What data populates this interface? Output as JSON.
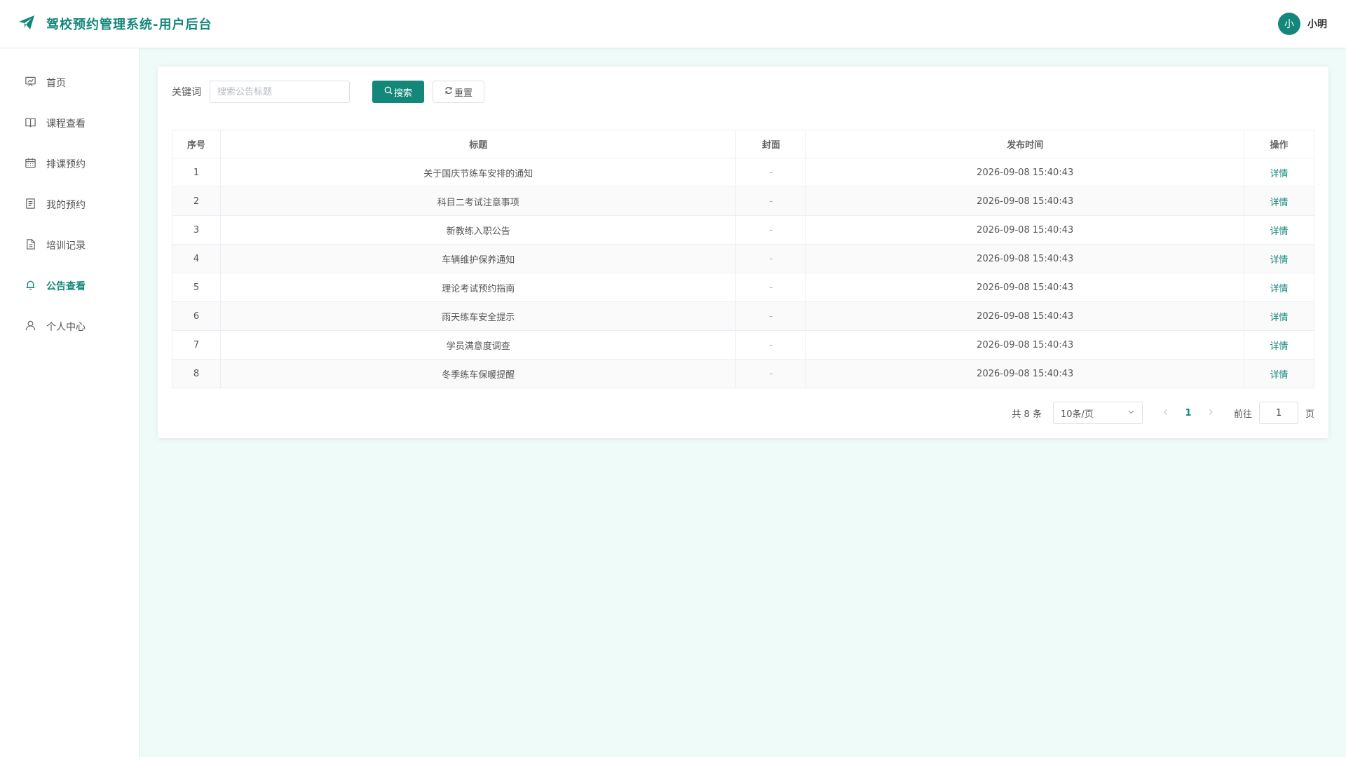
{
  "header": {
    "title": "驾校预约管理系统-用户后台",
    "user_avatar": "小",
    "user_name": "小明",
    "logo_icon": "paper-plane-icon"
  },
  "sidebar": {
    "items": [
      {
        "label": "首页",
        "icon": "chart-board-icon"
      },
      {
        "label": "课程查看",
        "icon": "book-icon"
      },
      {
        "label": "排课预约",
        "icon": "calendar-icon"
      },
      {
        "label": "我的预约",
        "icon": "document-icon"
      },
      {
        "label": "培训记录",
        "icon": "file-icon"
      },
      {
        "label": "公告查看",
        "icon": "bell-icon",
        "active": true
      },
      {
        "label": "个人中心",
        "icon": "user-icon"
      }
    ]
  },
  "search": {
    "label": "关键词",
    "placeholder": "搜索公告标题",
    "value": "",
    "search_label": "搜索",
    "reset_label": "重置"
  },
  "table": {
    "headers": [
      "序号",
      "标题",
      "封面",
      "发布时间",
      "操作"
    ],
    "rows": [
      {
        "seq": "1",
        "title": "关于国庆节练车安排的通知",
        "cover": "-",
        "time": "2026-09-08 15:40:43",
        "action": "详情"
      },
      {
        "seq": "2",
        "title": "科目二考试注意事项",
        "cover": "-",
        "time": "2026-09-08 15:40:43",
        "action": "详情"
      },
      {
        "seq": "3",
        "title": "新教练入职公告",
        "cover": "-",
        "time": "2026-09-08 15:40:43",
        "action": "详情"
      },
      {
        "seq": "4",
        "title": "车辆维护保养通知",
        "cover": "-",
        "time": "2026-09-08 15:40:43",
        "action": "详情"
      },
      {
        "seq": "5",
        "title": "理论考试预约指南",
        "cover": "-",
        "time": "2026-09-08 15:40:43",
        "action": "详情"
      },
      {
        "seq": "6",
        "title": "雨天练车安全提示",
        "cover": "-",
        "time": "2026-09-08 15:40:43",
        "action": "详情"
      },
      {
        "seq": "7",
        "title": "学员满意度调查",
        "cover": "-",
        "time": "2026-09-08 15:40:43",
        "action": "详情"
      },
      {
        "seq": "8",
        "title": "冬季练车保暖提醒",
        "cover": "-",
        "time": "2026-09-08 15:40:43",
        "action": "详情"
      }
    ]
  },
  "pagination": {
    "total_text": "共 8 条",
    "page_size": "10条/页",
    "current_page": "1",
    "goto_label": "前往",
    "goto_value": "1",
    "goto_suffix": "页"
  },
  "colors": {
    "accent": "#13877a",
    "background": "#effbf8"
  }
}
